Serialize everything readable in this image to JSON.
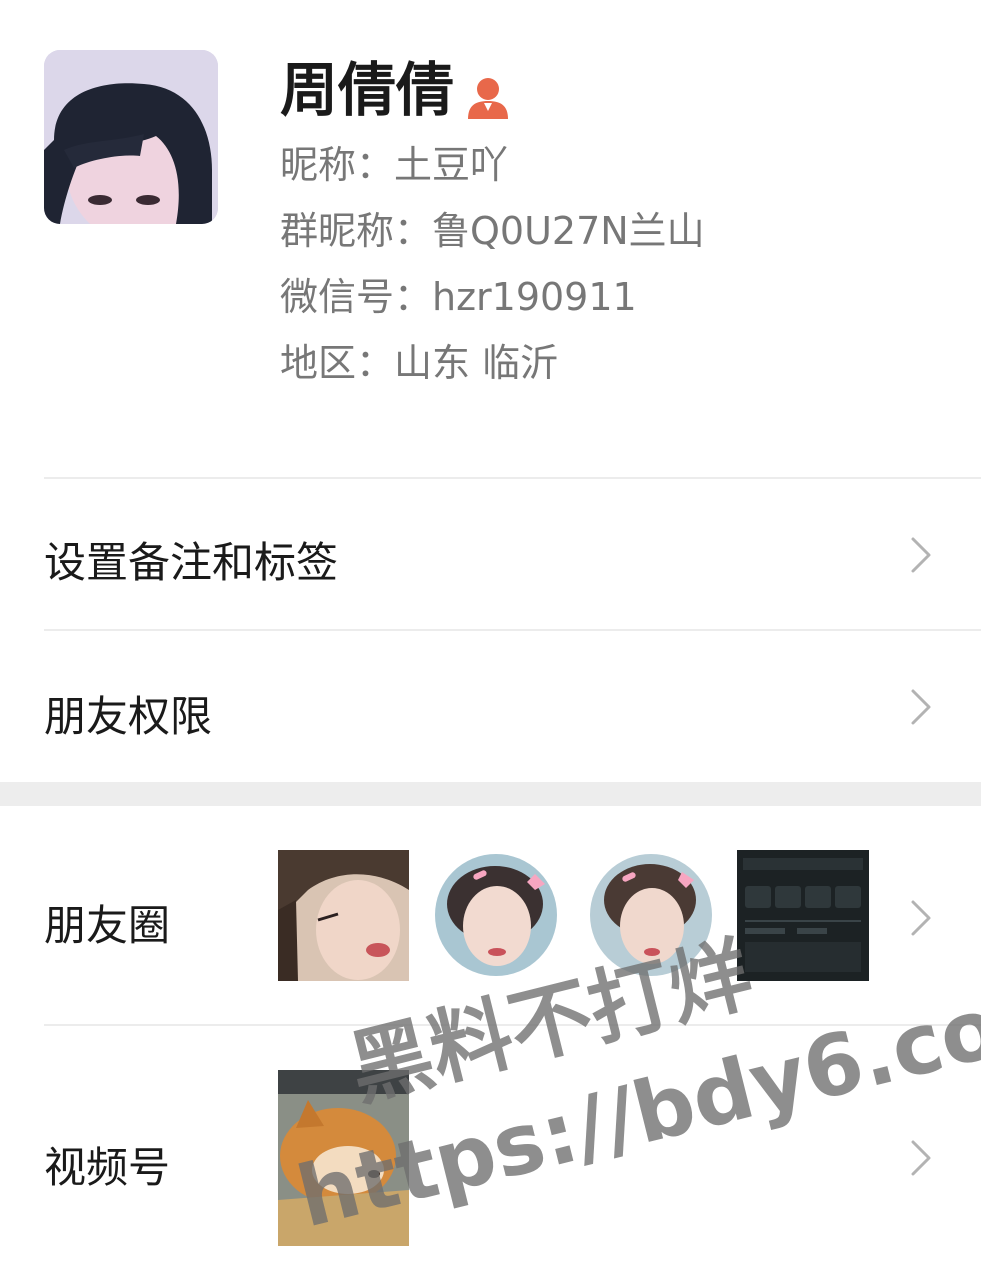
{
  "profile": {
    "name": "周倩倩",
    "nickname_line": "昵称：土豆吖",
    "group_nickname_line": "群昵称：鲁Q0U27N兰山",
    "wechat_id_line": "微信号：hzr190911",
    "region_line": "地区：山东  临沂",
    "badge_icon": "person-badge-icon",
    "badge_color": "#e8684a"
  },
  "menu": {
    "remark_tags": "设置备注和标签",
    "friend_permissions": "朋友权限",
    "moments": "朋友圈",
    "channels": "视频号"
  },
  "icons": {
    "chevron": "chevron-right-icon"
  },
  "watermark": {
    "line1": "黑料不打烊",
    "line2": "https://bdy6.co"
  }
}
